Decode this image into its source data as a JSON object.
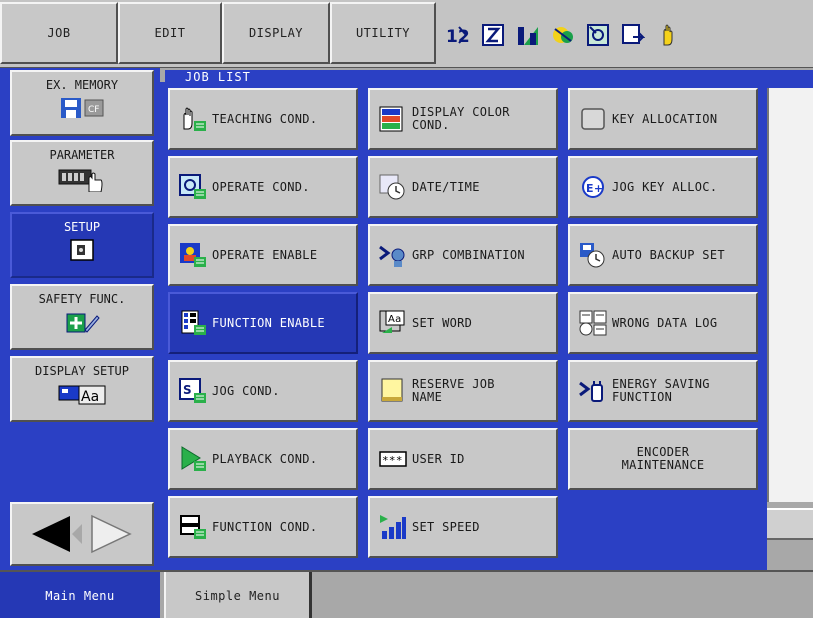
{
  "top_menu": {
    "items": [
      {
        "label": "JOB"
      },
      {
        "label": "EDIT"
      },
      {
        "label": "DISPLAY"
      },
      {
        "label": "UTILITY"
      }
    ],
    "status_icons": [
      "numbering-icon",
      "edit-lock-icon",
      "signal-icon",
      "brake-icon",
      "mode-icon",
      "output-icon",
      "hand-icon"
    ]
  },
  "left_menu": {
    "items": [
      {
        "label": "EX. MEMORY",
        "icon": "memory-card-icon"
      },
      {
        "label": "PARAMETER",
        "icon": "parameter-icon"
      },
      {
        "label": "SETUP",
        "icon": "setup-icon",
        "active": true
      },
      {
        "label": "SAFETY FUNC.",
        "icon": "safety-icon"
      },
      {
        "label": "DISPLAY SETUP",
        "icon": "display-setup-icon"
      }
    ],
    "nav": {
      "prev": "arrow-left-icon",
      "next": "arrow-right-icon"
    }
  },
  "window": {
    "title": "JOB LIST"
  },
  "setup_buttons": [
    {
      "label": "TEACHING COND.",
      "icon": "teaching-hand-icon"
    },
    {
      "label": "DISPLAY COLOR\nCOND.",
      "icon": "color-icon"
    },
    {
      "label": "KEY ALLOCATION",
      "icon": "key-icon"
    },
    {
      "label": "OPERATE COND.",
      "icon": "operate-cond-icon"
    },
    {
      "label": "DATE/TIME",
      "icon": "clock-icon"
    },
    {
      "label": "JOG KEY ALLOC.",
      "icon": "jog-key-icon"
    },
    {
      "label": "OPERATE ENABLE",
      "icon": "operate-enable-icon"
    },
    {
      "label": "GRP COMBINATION",
      "icon": "group-icon"
    },
    {
      "label": "AUTO BACKUP SET",
      "icon": "backup-icon"
    },
    {
      "label": "FUNCTION ENABLE",
      "icon": "function-enable-icon",
      "active": true
    },
    {
      "label": "SET WORD",
      "icon": "word-icon"
    },
    {
      "label": "WRONG DATA LOG",
      "icon": "log-icon"
    },
    {
      "label": "JOG COND.",
      "icon": "jog-icon"
    },
    {
      "label": "RESERVE JOB\nNAME",
      "icon": "note-icon"
    },
    {
      "label": "ENERGY SAVING\nFUNCTION",
      "icon": "energy-icon"
    },
    {
      "label": "PLAYBACK COND.",
      "icon": "playback-icon"
    },
    {
      "label": "USER ID",
      "icon": "user-id-icon"
    },
    {
      "label": "ENCODER\nMAINTENANCE",
      "icon": ""
    },
    {
      "label": "FUNCTION COND.",
      "icon": "function-cond-icon"
    },
    {
      "label": "SET SPEED",
      "icon": "speed-icon"
    }
  ],
  "bottom_tabs": [
    {
      "label": "Main Menu",
      "active": true
    },
    {
      "label": "Simple Menu"
    }
  ],
  "colors": {
    "panel_blue": "#2b40c4",
    "button_gray": "#c8c8c8",
    "active_blue": "#2538b5"
  }
}
